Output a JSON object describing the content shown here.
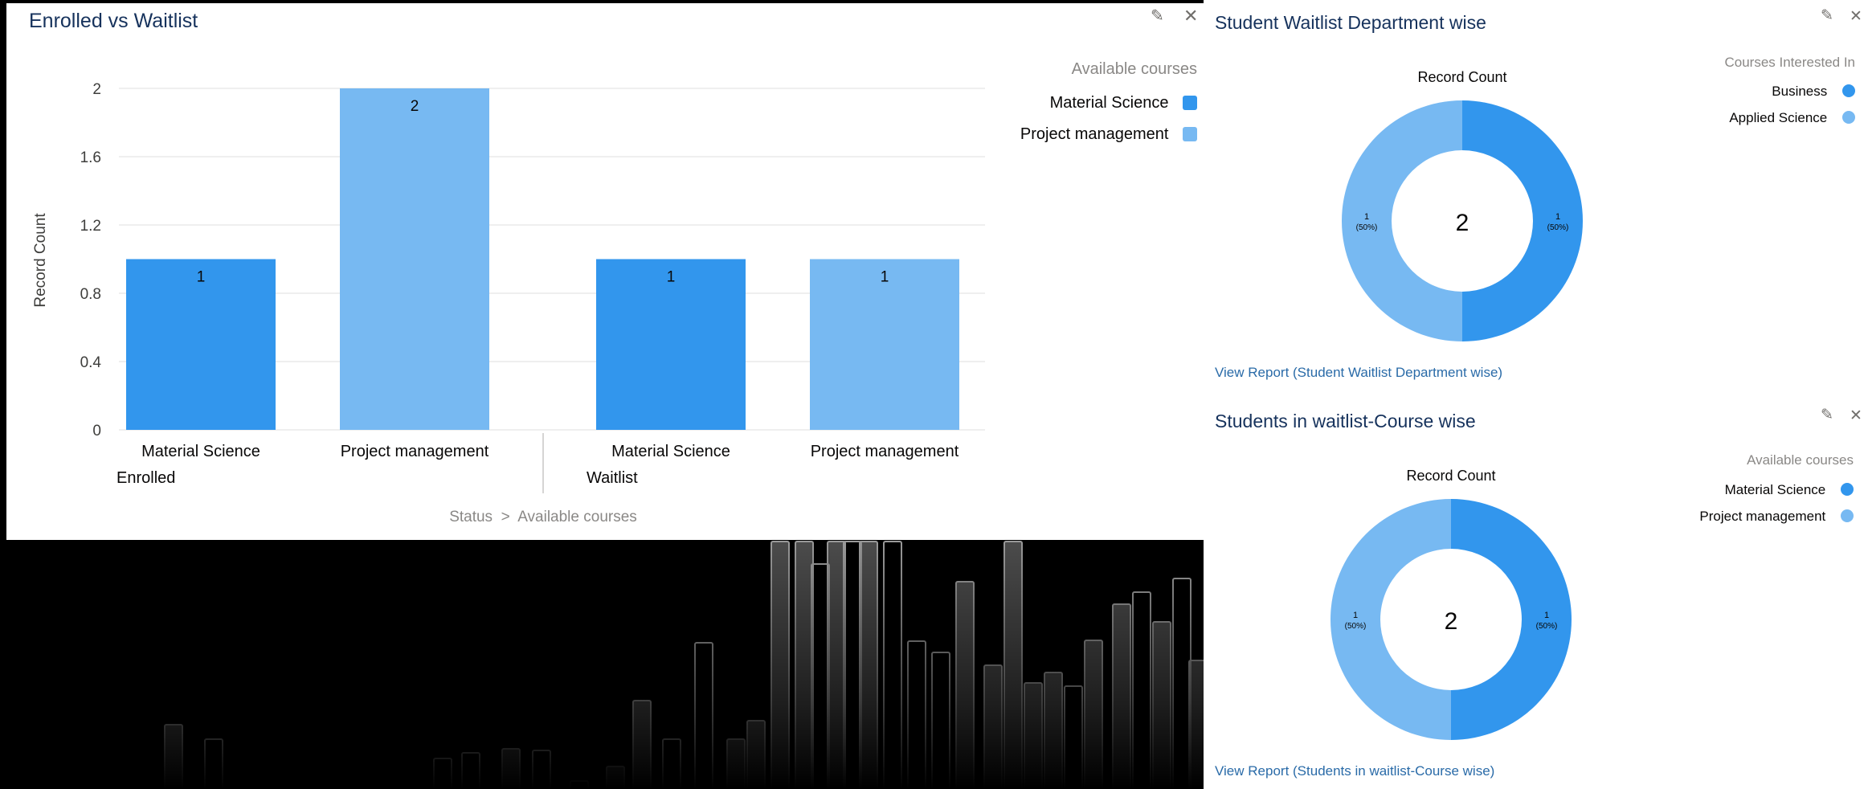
{
  "enrolled_panel": {
    "title": "Enrolled vs Waitlist",
    "axis_path": "Status  >  Available courses",
    "legend_title": "Available courses",
    "legend": [
      {
        "label": "Material Science",
        "color": "#3296ed"
      },
      {
        "label": "Project management",
        "color": "#77b9f2"
      }
    ],
    "group_labels": [
      "Enrolled",
      "Waitlist"
    ],
    "bar_labels": [
      "Material Science",
      "Project management",
      "Material Science",
      "Project management"
    ]
  },
  "dept_panel": {
    "title": "Student Waitlist Department wise",
    "legend_title": "Courses Interested In",
    "legend": [
      {
        "label": "Business",
        "color": "#3296ed"
      },
      {
        "label": "Applied Science",
        "color": "#77b9f2"
      }
    ],
    "metric": "Record Count",
    "center_value": "2",
    "view_report": "View Report (Student Waitlist Department wise)"
  },
  "course_panel": {
    "title": "Students in waitlist-Course wise",
    "legend_title": "Available courses",
    "legend": [
      {
        "label": "Material Science",
        "color": "#3296ed"
      },
      {
        "label": "Project management",
        "color": "#77b9f2"
      }
    ],
    "metric": "Record Count",
    "center_value": "2",
    "view_report": "View Report (Students in waitlist-Course wise)"
  },
  "chart_data": [
    {
      "type": "bar",
      "title": "Enrolled vs Waitlist",
      "xlabel": "Status  >  Available courses",
      "ylabel": "Record Count",
      "ylim": [
        0,
        2
      ],
      "yticks": [
        "0",
        "0.4",
        "0.8",
        "1.2",
        "1.6",
        "2"
      ],
      "groups": [
        "Enrolled",
        "Waitlist"
      ],
      "categories": [
        "Material Science",
        "Project management"
      ],
      "series": [
        {
          "name": "Material Science",
          "values": [
            1,
            1
          ],
          "color": "#3296ed"
        },
        {
          "name": "Project management",
          "values": [
            2,
            1
          ],
          "color": "#77b9f2"
        }
      ],
      "bar_value_labels": [
        "1",
        "2",
        "1",
        "1"
      ],
      "legend_position": "top-right"
    },
    {
      "type": "pie",
      "title": "Student Waitlist Department wise",
      "metric": "Record Count",
      "total": 2,
      "slices": [
        {
          "label": "Business",
          "value": 1,
          "percent": "(50%)",
          "color": "#3296ed"
        },
        {
          "label": "Applied Science",
          "value": 1,
          "percent": "(50%)",
          "color": "#77b9f2"
        }
      ],
      "legend_position": "top-right"
    },
    {
      "type": "pie",
      "title": "Students in waitlist-Course wise",
      "metric": "Record Count",
      "total": 2,
      "slices": [
        {
          "label": "Material Science",
          "value": 1,
          "percent": "(50%)",
          "color": "#3296ed"
        },
        {
          "label": "Project management",
          "value": 1,
          "percent": "(50%)",
          "color": "#77b9f2"
        }
      ],
      "legend_position": "top-right"
    }
  ]
}
